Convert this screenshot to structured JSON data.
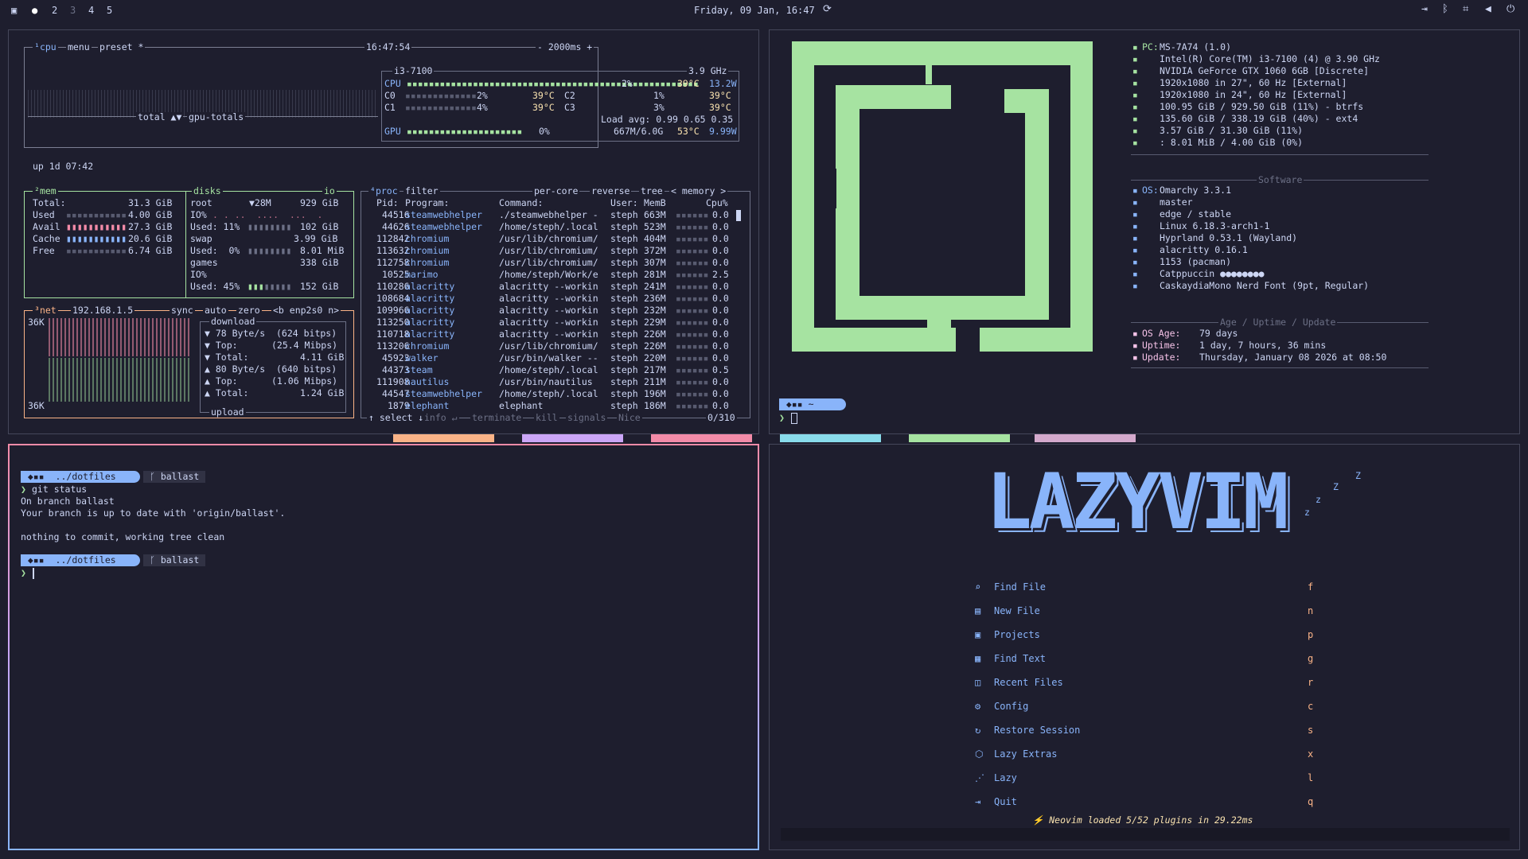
{
  "topbar": {
    "workspaces": [
      "2",
      "3",
      "4",
      "5"
    ],
    "clock": "Friday, 09 Jan, 16:47"
  },
  "btop": {
    "cpu_tabs": [
      "cpu",
      "menu",
      "preset *"
    ],
    "time": "16:47:54",
    "interval": "- 2000ms +",
    "graph_label": "total",
    "gpu_label": "gpu-totals",
    "uptime": "up 1d 07:42",
    "cpu_name": "i3-7100",
    "cpu_freq": "3.9 GHz",
    "cpu_rows": [
      {
        "name": "CPU",
        "pct": "2%",
        "temp": "39°C",
        "power": "13.2W"
      },
      {
        "name": "C0",
        "pct": "2%",
        "temp": "39°C",
        "name2": "C2",
        "pct2": "1%",
        "temp2": "39°C"
      },
      {
        "name": "C1",
        "pct": "4%",
        "temp": "39°C",
        "name2": "C3",
        "pct2": "3%",
        "temp2": "39°C"
      }
    ],
    "load_avg": "Load avg: 0.99 0.65 0.35",
    "gpu_row": {
      "name": "GPU",
      "pct": "0%",
      "mem": "667M/6.0G",
      "temp": "53°C",
      "power": "9.99W"
    },
    "mem": {
      "title": "mem",
      "rows": [
        {
          "k": "Total:",
          "v": "31.3 GiB"
        },
        {
          "k": "Used",
          "v": "4.00 GiB"
        },
        {
          "k": "Avail",
          "v": "27.3 GiB"
        },
        {
          "k": "Cache",
          "v": "20.6 GiB"
        },
        {
          "k": "Free",
          "v": "6.74 GiB"
        }
      ]
    },
    "disks": {
      "title": "disks",
      "io": "io",
      "root": "root",
      "root_speed": "▼28M",
      "root_size": "929 GiB",
      "root_io": "IO%",
      "root_used": "Used: 11%",
      "root_used_v": "102 GiB",
      "swap": "swap",
      "swap_size": "3.99 GiB",
      "swap_used": "Used:  0%",
      "swap_used_v": "8.01 MiB",
      "games": "games",
      "games_size": "338 GiB",
      "games_io": "IO%",
      "games_used": "Used: 45%",
      "games_used_v": "152 GiB"
    },
    "net": {
      "title": "net",
      "ip": "192.168.1.5",
      "tabs": [
        "sync",
        "auto",
        "zero",
        "<b enp2s0 n>"
      ],
      "scale_top": "36K",
      "scale_bottom": "36K",
      "download": "download",
      "upload": "upload",
      "rows": [
        {
          "k": "▼ 78 Byte/s",
          "v": "(624 bitps)"
        },
        {
          "k": "▼ Top:",
          "v": "(25.4 Mibps)"
        },
        {
          "k": "▼ Total:",
          "v": "4.11 GiB"
        },
        {
          "k": "▲ 80 Byte/s",
          "v": "(640 bitps)"
        },
        {
          "k": "▲ Top:",
          "v": "(1.06 Mibps)"
        },
        {
          "k": "▲ Total:",
          "v": "1.24 GiB"
        }
      ]
    },
    "proc": {
      "tabs": [
        "proc",
        "filter",
        "per-core",
        "reverse",
        "tree",
        "< memory >"
      ],
      "headers": {
        "pid": "Pid:",
        "program": "Program:",
        "command": "Command:",
        "user": "User:",
        "mem": "MemB",
        "cpu": "Cpu%"
      },
      "rows": [
        {
          "pid": "44516",
          "program": "steamwebhelper",
          "command": "./steamwebhelper -",
          "user": "steph",
          "mem": "663M",
          "cpu": "0.0"
        },
        {
          "pid": "44626",
          "program": "steamwebhelper",
          "command": "/home/steph/.local",
          "user": "steph",
          "mem": "523M",
          "cpu": "0.0"
        },
        {
          "pid": "112842",
          "program": "chromium",
          "command": "/usr/lib/chromium/",
          "user": "steph",
          "mem": "404M",
          "cpu": "0.0"
        },
        {
          "pid": "113632",
          "program": "chromium",
          "command": "/usr/lib/chromium/",
          "user": "steph",
          "mem": "372M",
          "cpu": "0.0"
        },
        {
          "pid": "112758",
          "program": "chromium",
          "command": "/usr/lib/chromium/",
          "user": "steph",
          "mem": "307M",
          "cpu": "0.0"
        },
        {
          "pid": "10525",
          "program": "marimo",
          "command": "/home/steph/Work/e",
          "user": "steph",
          "mem": "281M",
          "cpu": "2.5"
        },
        {
          "pid": "110286",
          "program": "alacritty",
          "command": "alacritty --workin",
          "user": "steph",
          "mem": "241M",
          "cpu": "0.0"
        },
        {
          "pid": "108684",
          "program": "alacritty",
          "command": "alacritty --workin",
          "user": "steph",
          "mem": "236M",
          "cpu": "0.0"
        },
        {
          "pid": "109966",
          "program": "alacritty",
          "command": "alacritty --workin",
          "user": "steph",
          "mem": "232M",
          "cpu": "0.0"
        },
        {
          "pid": "113250",
          "program": "alacritty",
          "command": "alacritty --workin",
          "user": "steph",
          "mem": "229M",
          "cpu": "0.0"
        },
        {
          "pid": "110718",
          "program": "alacritty",
          "command": "alacritty --workin",
          "user": "steph",
          "mem": "226M",
          "cpu": "0.0"
        },
        {
          "pid": "113206",
          "program": "chromium",
          "command": "/usr/lib/chromium/",
          "user": "steph",
          "mem": "226M",
          "cpu": "0.0"
        },
        {
          "pid": "45923",
          "program": "walker",
          "command": "/usr/bin/walker --",
          "user": "steph",
          "mem": "220M",
          "cpu": "0.0"
        },
        {
          "pid": "44373",
          "program": "steam",
          "command": "/home/steph/.local",
          "user": "steph",
          "mem": "217M",
          "cpu": "0.5"
        },
        {
          "pid": "111908",
          "program": "nautilus",
          "command": "/usr/bin/nautilus",
          "user": "steph",
          "mem": "211M",
          "cpu": "0.0"
        },
        {
          "pid": "44547",
          "program": "steamwebhelper",
          "command": "/home/steph/.local",
          "user": "steph",
          "mem": "196M",
          "cpu": "0.0"
        },
        {
          "pid": "1879",
          "program": "elephant",
          "command": "elephant",
          "user": "steph",
          "mem": "186M",
          "cpu": "0.0"
        }
      ],
      "footer": [
        "↑ select ↓",
        "info ↵",
        "terminate",
        "kill",
        "signals",
        "Nice"
      ],
      "count": "0/310"
    }
  },
  "fastfetch": {
    "prompt_path": "~",
    "hardware": [
      {
        "k": "PC:",
        "v": "MS-7A74 (1.0)"
      },
      {
        "k": "",
        "v": "Intel(R) Core(TM) i3-7100 (4) @ 3.90 GHz"
      },
      {
        "k": "",
        "v": "NVIDIA GeForce GTX 1060 6GB [Discrete]"
      },
      {
        "k": "",
        "v": "1920x1080 in 27\", 60 Hz [External]"
      },
      {
        "k": "",
        "v": "1920x1080 in 24\", 60 Hz [External]"
      },
      {
        "k": "",
        "v": "100.95 GiB / 929.50 GiB (11%) - btrfs"
      },
      {
        "k": "",
        "v": "135.60 GiB / 338.19 GiB (40%) - ext4"
      },
      {
        "k": "",
        "v": "3.57 GiB / 31.30 GiB (11%)"
      },
      {
        "k": "",
        "v": ": 8.01 MiB / 4.00 GiB (0%)"
      }
    ],
    "software_title": "Software",
    "software": [
      {
        "k": "OS:",
        "v": "Omarchy 3.3.1"
      },
      {
        "k": "",
        "v": "master"
      },
      {
        "k": "",
        "v": "edge / stable"
      },
      {
        "k": "",
        "v": "Linux 6.18.3-arch1-1"
      },
      {
        "k": "",
        "v": "Hyprland 0.53.1 (Wayland)"
      },
      {
        "k": "",
        "v": "alacritty 0.16.1"
      },
      {
        "k": "",
        "v": "1153 (pacman)"
      },
      {
        "k": "",
        "v": "Catppuccin ●●●●●●●●"
      },
      {
        "k": "",
        "v": "CaskaydiaMono Nerd Font (9pt, Regular)"
      }
    ],
    "age_title": "Age / Uptime / Update",
    "age": [
      {
        "k": "OS Age:",
        "v": "79 days"
      },
      {
        "k": "Uptime:",
        "v": "1 day, 7 hours, 36 mins"
      },
      {
        "k": "Update:",
        "v": "Thursday, January 08 2026 at 08:50"
      }
    ]
  },
  "terminal": {
    "path": "../dotfiles",
    "branch": "ballast",
    "command": "git status",
    "output": [
      "On branch ballast",
      "Your branch is up to date with 'origin/ballast'.",
      "",
      "nothing to commit, working tree clean"
    ]
  },
  "lazyvim": {
    "logo": "LAZYVIM",
    "zzz": [
      "Z",
      "Z",
      "z",
      "z"
    ],
    "menu": [
      {
        "label": "Find File",
        "key": "f",
        "icon": "search-icon"
      },
      {
        "label": "New File",
        "key": "n",
        "icon": "file-icon"
      },
      {
        "label": "Projects",
        "key": "p",
        "icon": "folder-icon"
      },
      {
        "label": "Find Text",
        "key": "g",
        "icon": "text-search-icon"
      },
      {
        "label": "Recent Files",
        "key": "r",
        "icon": "recent-icon"
      },
      {
        "label": "Config",
        "key": "c",
        "icon": "gear-icon"
      },
      {
        "label": "Restore Session",
        "key": "s",
        "icon": "restore-icon"
      },
      {
        "label": "Lazy Extras",
        "key": "x",
        "icon": "package-icon"
      },
      {
        "label": "Lazy",
        "key": "l",
        "icon": "lazy-icon"
      },
      {
        "label": "Quit",
        "key": "q",
        "icon": "quit-icon"
      }
    ],
    "footer": "Neovim loaded 5/52 plugins in 29.22ms"
  },
  "colors": {
    "bg": "#1e1e2e",
    "fg": "#cdd6f4",
    "green": "#a6e3a1",
    "blue": "#89b4fa",
    "red": "#f38ba8",
    "mauve": "#cba6f7",
    "peach": "#fab387",
    "yellow": "#f9e2af"
  }
}
